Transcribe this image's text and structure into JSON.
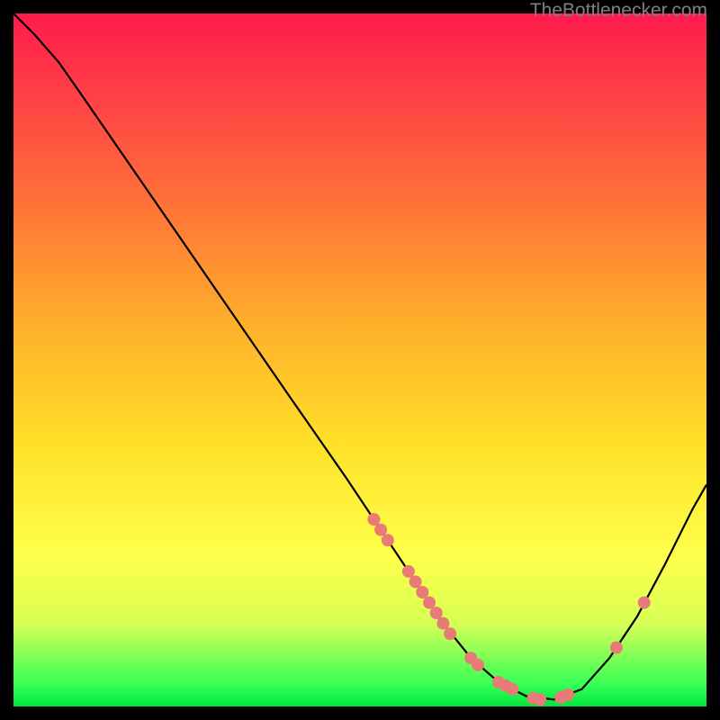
{
  "credit": "TheBottlenecker.com",
  "chart_data": {
    "type": "line",
    "title": "",
    "xlabel": "",
    "ylabel": "",
    "xlim": [
      0,
      100
    ],
    "ylim": [
      0,
      100
    ],
    "curve": [
      {
        "x": 0.0,
        "y": 100.0
      },
      {
        "x": 3.0,
        "y": 97.0
      },
      {
        "x": 6.5,
        "y": 93.0
      },
      {
        "x": 10.0,
        "y": 88.0
      },
      {
        "x": 20.0,
        "y": 73.5
      },
      {
        "x": 30.0,
        "y": 59.0
      },
      {
        "x": 40.0,
        "y": 44.5
      },
      {
        "x": 48.0,
        "y": 33.0
      },
      {
        "x": 54.0,
        "y": 24.0
      },
      {
        "x": 58.0,
        "y": 18.0
      },
      {
        "x": 62.0,
        "y": 12.0
      },
      {
        "x": 66.0,
        "y": 7.0
      },
      {
        "x": 70.0,
        "y": 3.5
      },
      {
        "x": 74.0,
        "y": 1.5
      },
      {
        "x": 78.0,
        "y": 1.0
      },
      {
        "x": 82.0,
        "y": 2.5
      },
      {
        "x": 86.0,
        "y": 7.0
      },
      {
        "x": 90.0,
        "y": 13.0
      },
      {
        "x": 94.0,
        "y": 20.5
      },
      {
        "x": 98.0,
        "y": 28.5
      },
      {
        "x": 100.0,
        "y": 32.0
      }
    ],
    "markers": [
      {
        "x": 52.0,
        "y": 27.0
      },
      {
        "x": 53.0,
        "y": 25.5
      },
      {
        "x": 54.0,
        "y": 24.0
      },
      {
        "x": 57.0,
        "y": 19.5
      },
      {
        "x": 58.0,
        "y": 18.0
      },
      {
        "x": 59.0,
        "y": 16.5
      },
      {
        "x": 60.0,
        "y": 15.0
      },
      {
        "x": 61.0,
        "y": 13.5
      },
      {
        "x": 62.0,
        "y": 12.0
      },
      {
        "x": 63.0,
        "y": 10.5
      },
      {
        "x": 66.0,
        "y": 7.0
      },
      {
        "x": 67.0,
        "y": 6.0
      },
      {
        "x": 70.0,
        "y": 3.5
      },
      {
        "x": 71.0,
        "y": 3.0
      },
      {
        "x": 72.0,
        "y": 2.5
      },
      {
        "x": 75.0,
        "y": 1.2
      },
      {
        "x": 76.0,
        "y": 1.0
      },
      {
        "x": 79.0,
        "y": 1.3
      },
      {
        "x": 80.0,
        "y": 1.7
      },
      {
        "x": 87.0,
        "y": 8.5
      },
      {
        "x": 91.0,
        "y": 15.0
      }
    ]
  }
}
